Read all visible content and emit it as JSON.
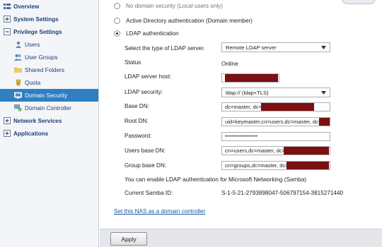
{
  "sidebar": {
    "overview": "Overview",
    "system_settings": "System Settings",
    "privilege_settings": "Privilege Settings",
    "users": "Users",
    "user_groups": "User Groups",
    "shared_folders": "Shared Folders",
    "quota": "Quota",
    "domain_security": "Domain Security",
    "domain_controller": "Domain Controller",
    "network_services": "Network Services",
    "applications": "Applications"
  },
  "options": {
    "no_domain": "No domain security (Local users only)",
    "active_directory": "Active Directory authentication (Domain member)",
    "ldap": "LDAP authentication"
  },
  "form": {
    "server_type_label": "Select the type of LDAP server.",
    "server_type_value": "Remote LDAP server",
    "status_label": "Status",
    "status_value": "Online",
    "host_label": "LDAP server host:",
    "security_label": "LDAP security:",
    "security_value": "ldap:// (ldap+TLS)",
    "base_dn_label": "Base DN:",
    "base_dn_value": "dc=master, dc=",
    "root_dn_label": "Root DN:",
    "root_dn_value": "uid=keymaster,cn=users,dc=master, dc=",
    "password_label": "Password:",
    "password_value": "••••••••••••••••••••",
    "users_base_label": "Users base DN:",
    "users_base_value": "cn=users,dc=master, dc=",
    "group_base_label": "Group base DN:",
    "group_base_value": "cn=groups,dc=master, dc=",
    "samba_note": "You can enable LDAP authentication for Microsoft Networking (Samba)",
    "samba_id_label": "Current Samba ID:",
    "samba_id_value": "S-1-5-21-2793898047-506797154-3815271440"
  },
  "links": {
    "set_dc": "Set this NAS as a domain controller"
  },
  "footer": {
    "apply": "Apply"
  },
  "colors": {
    "active_nav": "#2f7fc2",
    "redaction": "#7a1010",
    "link": "#1a55a8"
  }
}
